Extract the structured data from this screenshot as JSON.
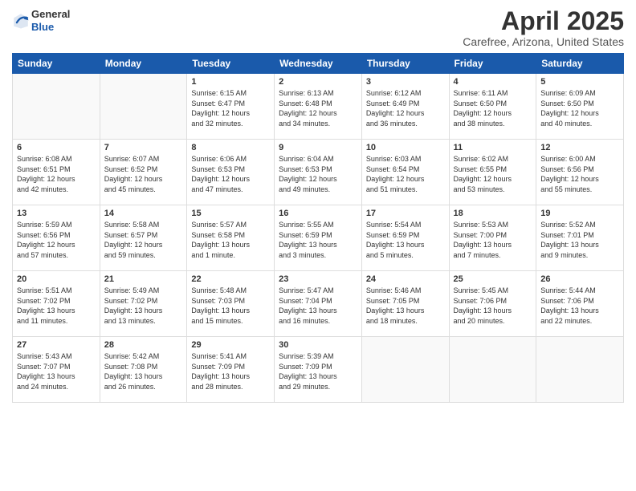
{
  "header": {
    "logo_general": "General",
    "logo_blue": "Blue",
    "title": "April 2025",
    "subtitle": "Carefree, Arizona, United States"
  },
  "weekdays": [
    "Sunday",
    "Monday",
    "Tuesday",
    "Wednesday",
    "Thursday",
    "Friday",
    "Saturday"
  ],
  "weeks": [
    [
      {
        "day": "",
        "sunrise": "",
        "sunset": "",
        "daylight": ""
      },
      {
        "day": "",
        "sunrise": "",
        "sunset": "",
        "daylight": ""
      },
      {
        "day": "1",
        "sunrise": "Sunrise: 6:15 AM",
        "sunset": "Sunset: 6:47 PM",
        "daylight": "Daylight: 12 hours and 32 minutes."
      },
      {
        "day": "2",
        "sunrise": "Sunrise: 6:13 AM",
        "sunset": "Sunset: 6:48 PM",
        "daylight": "Daylight: 12 hours and 34 minutes."
      },
      {
        "day": "3",
        "sunrise": "Sunrise: 6:12 AM",
        "sunset": "Sunset: 6:49 PM",
        "daylight": "Daylight: 12 hours and 36 minutes."
      },
      {
        "day": "4",
        "sunrise": "Sunrise: 6:11 AM",
        "sunset": "Sunset: 6:50 PM",
        "daylight": "Daylight: 12 hours and 38 minutes."
      },
      {
        "day": "5",
        "sunrise": "Sunrise: 6:09 AM",
        "sunset": "Sunset: 6:50 PM",
        "daylight": "Daylight: 12 hours and 40 minutes."
      }
    ],
    [
      {
        "day": "6",
        "sunrise": "Sunrise: 6:08 AM",
        "sunset": "Sunset: 6:51 PM",
        "daylight": "Daylight: 12 hours and 42 minutes."
      },
      {
        "day": "7",
        "sunrise": "Sunrise: 6:07 AM",
        "sunset": "Sunset: 6:52 PM",
        "daylight": "Daylight: 12 hours and 45 minutes."
      },
      {
        "day": "8",
        "sunrise": "Sunrise: 6:06 AM",
        "sunset": "Sunset: 6:53 PM",
        "daylight": "Daylight: 12 hours and 47 minutes."
      },
      {
        "day": "9",
        "sunrise": "Sunrise: 6:04 AM",
        "sunset": "Sunset: 6:53 PM",
        "daylight": "Daylight: 12 hours and 49 minutes."
      },
      {
        "day": "10",
        "sunrise": "Sunrise: 6:03 AM",
        "sunset": "Sunset: 6:54 PM",
        "daylight": "Daylight: 12 hours and 51 minutes."
      },
      {
        "day": "11",
        "sunrise": "Sunrise: 6:02 AM",
        "sunset": "Sunset: 6:55 PM",
        "daylight": "Daylight: 12 hours and 53 minutes."
      },
      {
        "day": "12",
        "sunrise": "Sunrise: 6:00 AM",
        "sunset": "Sunset: 6:56 PM",
        "daylight": "Daylight: 12 hours and 55 minutes."
      }
    ],
    [
      {
        "day": "13",
        "sunrise": "Sunrise: 5:59 AM",
        "sunset": "Sunset: 6:56 PM",
        "daylight": "Daylight: 12 hours and 57 minutes."
      },
      {
        "day": "14",
        "sunrise": "Sunrise: 5:58 AM",
        "sunset": "Sunset: 6:57 PM",
        "daylight": "Daylight: 12 hours and 59 minutes."
      },
      {
        "day": "15",
        "sunrise": "Sunrise: 5:57 AM",
        "sunset": "Sunset: 6:58 PM",
        "daylight": "Daylight: 13 hours and 1 minute."
      },
      {
        "day": "16",
        "sunrise": "Sunrise: 5:55 AM",
        "sunset": "Sunset: 6:59 PM",
        "daylight": "Daylight: 13 hours and 3 minutes."
      },
      {
        "day": "17",
        "sunrise": "Sunrise: 5:54 AM",
        "sunset": "Sunset: 6:59 PM",
        "daylight": "Daylight: 13 hours and 5 minutes."
      },
      {
        "day": "18",
        "sunrise": "Sunrise: 5:53 AM",
        "sunset": "Sunset: 7:00 PM",
        "daylight": "Daylight: 13 hours and 7 minutes."
      },
      {
        "day": "19",
        "sunrise": "Sunrise: 5:52 AM",
        "sunset": "Sunset: 7:01 PM",
        "daylight": "Daylight: 13 hours and 9 minutes."
      }
    ],
    [
      {
        "day": "20",
        "sunrise": "Sunrise: 5:51 AM",
        "sunset": "Sunset: 7:02 PM",
        "daylight": "Daylight: 13 hours and 11 minutes."
      },
      {
        "day": "21",
        "sunrise": "Sunrise: 5:49 AM",
        "sunset": "Sunset: 7:02 PM",
        "daylight": "Daylight: 13 hours and 13 minutes."
      },
      {
        "day": "22",
        "sunrise": "Sunrise: 5:48 AM",
        "sunset": "Sunset: 7:03 PM",
        "daylight": "Daylight: 13 hours and 15 minutes."
      },
      {
        "day": "23",
        "sunrise": "Sunrise: 5:47 AM",
        "sunset": "Sunset: 7:04 PM",
        "daylight": "Daylight: 13 hours and 16 minutes."
      },
      {
        "day": "24",
        "sunrise": "Sunrise: 5:46 AM",
        "sunset": "Sunset: 7:05 PM",
        "daylight": "Daylight: 13 hours and 18 minutes."
      },
      {
        "day": "25",
        "sunrise": "Sunrise: 5:45 AM",
        "sunset": "Sunset: 7:06 PM",
        "daylight": "Daylight: 13 hours and 20 minutes."
      },
      {
        "day": "26",
        "sunrise": "Sunrise: 5:44 AM",
        "sunset": "Sunset: 7:06 PM",
        "daylight": "Daylight: 13 hours and 22 minutes."
      }
    ],
    [
      {
        "day": "27",
        "sunrise": "Sunrise: 5:43 AM",
        "sunset": "Sunset: 7:07 PM",
        "daylight": "Daylight: 13 hours and 24 minutes."
      },
      {
        "day": "28",
        "sunrise": "Sunrise: 5:42 AM",
        "sunset": "Sunset: 7:08 PM",
        "daylight": "Daylight: 13 hours and 26 minutes."
      },
      {
        "day": "29",
        "sunrise": "Sunrise: 5:41 AM",
        "sunset": "Sunset: 7:09 PM",
        "daylight": "Daylight: 13 hours and 28 minutes."
      },
      {
        "day": "30",
        "sunrise": "Sunrise: 5:39 AM",
        "sunset": "Sunset: 7:09 PM",
        "daylight": "Daylight: 13 hours and 29 minutes."
      },
      {
        "day": "",
        "sunrise": "",
        "sunset": "",
        "daylight": ""
      },
      {
        "day": "",
        "sunrise": "",
        "sunset": "",
        "daylight": ""
      },
      {
        "day": "",
        "sunrise": "",
        "sunset": "",
        "daylight": ""
      }
    ]
  ]
}
